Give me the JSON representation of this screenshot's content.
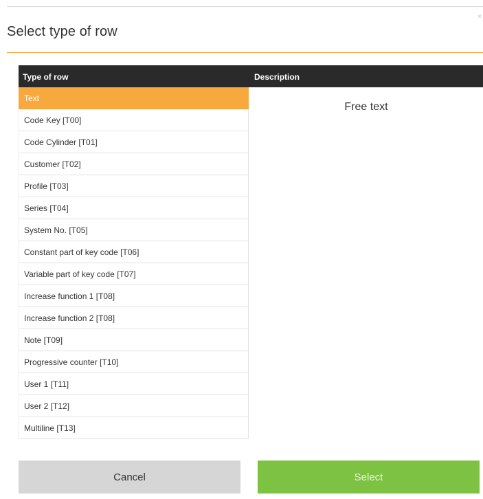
{
  "dialog": {
    "title": "Select type of row",
    "close_glyph": "×",
    "close_icon": "close-icon",
    "accent_color": "#f0a52e"
  },
  "table": {
    "headers": {
      "type": "Type of row",
      "description": "Description"
    },
    "rows": [
      {
        "label": "Text",
        "selected": true
      },
      {
        "label": "Code Key [T00]",
        "selected": false
      },
      {
        "label": "Code Cylinder [T01]",
        "selected": false
      },
      {
        "label": "Customer [T02]",
        "selected": false
      },
      {
        "label": "Profile [T03]",
        "selected": false
      },
      {
        "label": "Series [T04]",
        "selected": false
      },
      {
        "label": "System No. [T05]",
        "selected": false
      },
      {
        "label": "Constant part of key code [T06]",
        "selected": false
      },
      {
        "label": "Variable part of key code [T07]",
        "selected": false
      },
      {
        "label": "Increase function 1 [T08]",
        "selected": false
      },
      {
        "label": "Increase function 2 [T08]",
        "selected": false
      },
      {
        "label": "Note [T09]",
        "selected": false
      },
      {
        "label": "Progressive counter [T10]",
        "selected": false
      },
      {
        "label": "User 1 [T11]",
        "selected": false
      },
      {
        "label": "User 2 [T12]",
        "selected": false
      },
      {
        "label": "Multiline [T13]",
        "selected": false
      }
    ],
    "selected_color": "#f8a93e",
    "header_color": "#2a2a2a"
  },
  "description": {
    "text": "Free text"
  },
  "buttons": {
    "cancel_label": "Cancel",
    "select_label": "Select",
    "cancel_color": "#d6d6d6",
    "select_color": "#7dc242"
  }
}
